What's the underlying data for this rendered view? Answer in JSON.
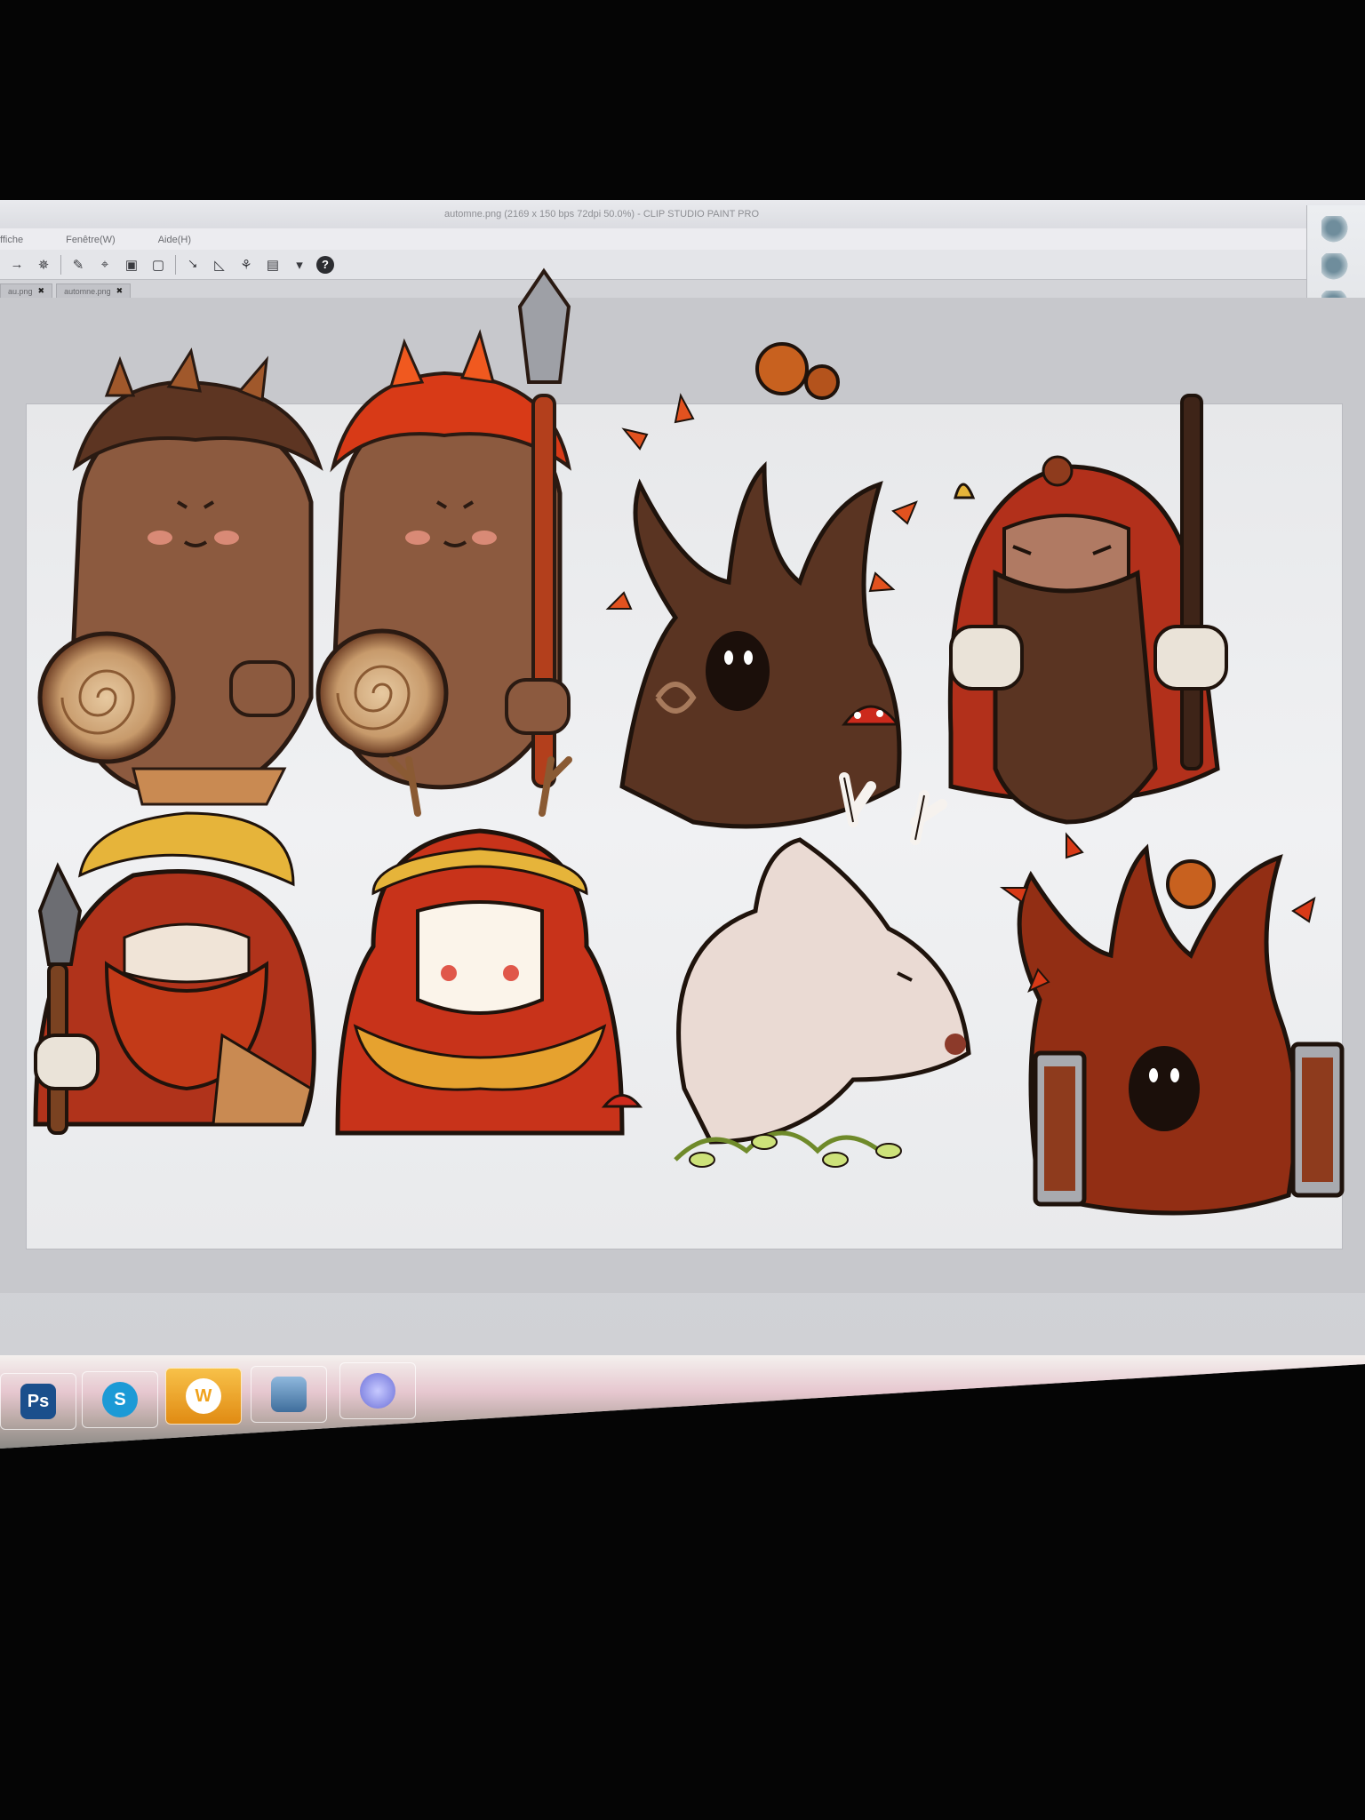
{
  "window": {
    "title": "automne.png (2169 x 150 bps 72dpi 50.0%) - CLIP STUDIO PAINT PRO"
  },
  "menu": {
    "items": [
      {
        "label": "ffiche"
      },
      {
        "label": "Fenêtre(W)"
      },
      {
        "label": "Aide(H)"
      }
    ]
  },
  "tabs": [
    {
      "label": "au.png"
    },
    {
      "label": "automne.png"
    }
  ],
  "toolbar": {
    "help_label": "?"
  },
  "taskbar": {
    "apps": [
      {
        "name": "Photoshop",
        "glyph": "Ps",
        "color": "#1b4f8c"
      },
      {
        "name": "Skype",
        "glyph": "S",
        "color": "#1c9ad6"
      },
      {
        "name": "Wamp",
        "glyph": "W",
        "color": "#f0a21c"
      },
      {
        "name": "Image viewer",
        "glyph": "",
        "color": "#5f8ab7"
      },
      {
        "name": "Clip Studio",
        "glyph": "",
        "color": "#6b6fd8"
      }
    ]
  },
  "colors": {
    "accent_red": "#c8331a",
    "wood_brown": "#5a3422",
    "leaf_orange": "#e2521f",
    "leaf_gold": "#e6b43a"
  }
}
